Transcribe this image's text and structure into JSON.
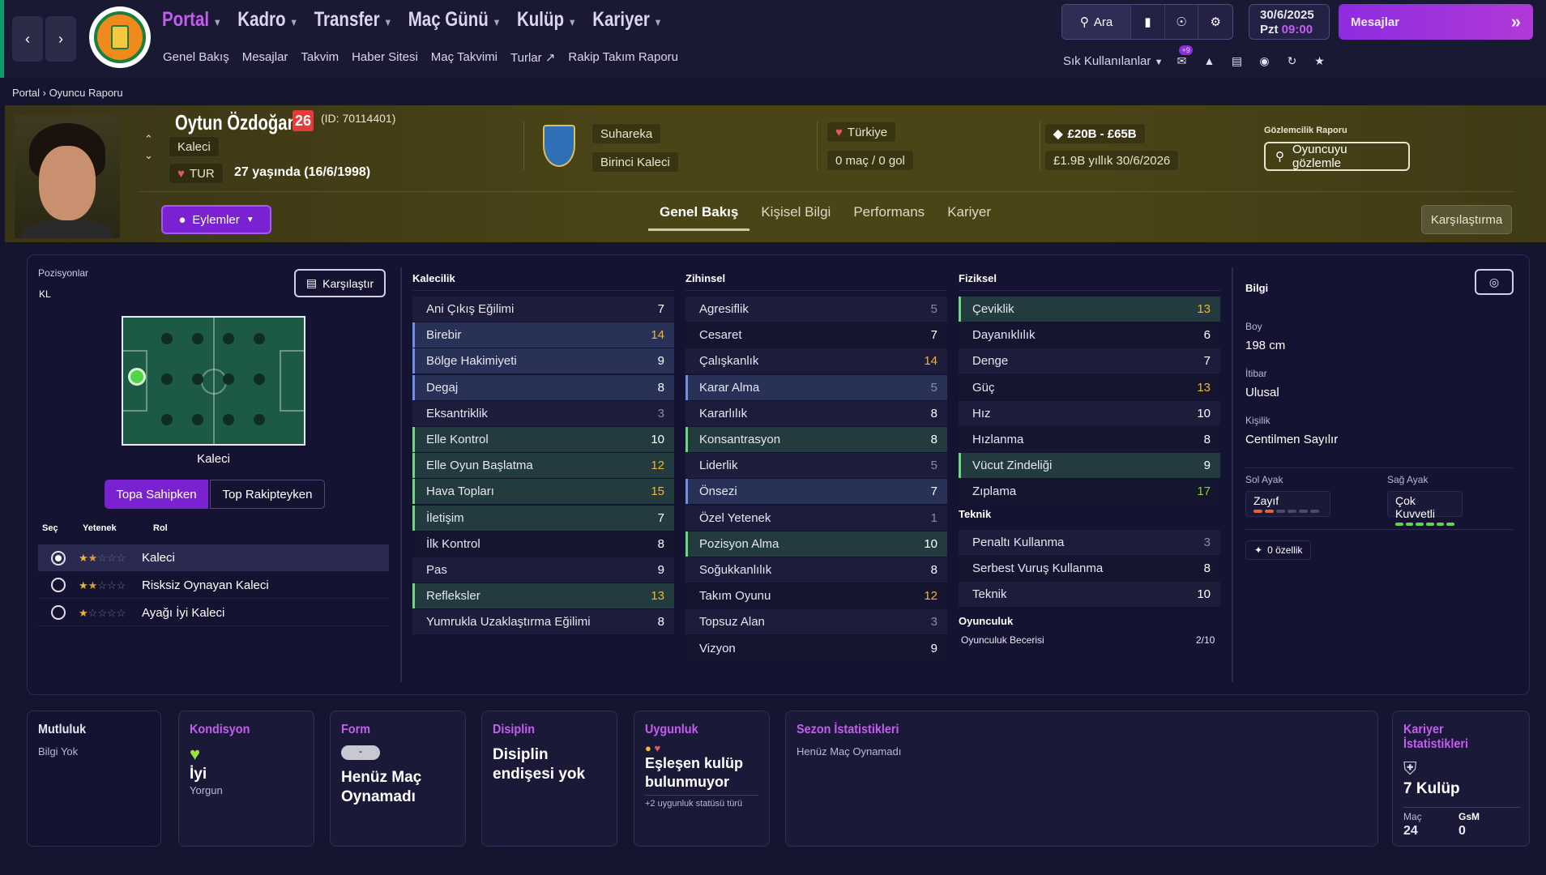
{
  "nav": {
    "main": [
      "Portal",
      "Kadro",
      "Transfer",
      "Maç Günü",
      "Kulüp",
      "Kariyer"
    ],
    "sub": [
      "Genel Bakış",
      "Mesajlar",
      "Takvim",
      "Haber Sitesi",
      "Maç Takvimi",
      "Turlar",
      "Rakip Takım Raporu"
    ],
    "search": "Ara",
    "date": "30/6/2025",
    "day": "Pzt",
    "time": "09:00",
    "messages": "Mesajlar",
    "favorites": "Sık Kullanılanlar",
    "badge": "+9"
  },
  "breadcrumb": {
    "a": "Portal",
    "b": "Oyuncu Raporu"
  },
  "player": {
    "name": "Oytun Özdoğan",
    "number": "26",
    "id": "(ID: 70114401)",
    "position": "Kaleci",
    "nation": "TUR",
    "age": "27 yaşında (16/6/1998)",
    "club": "Suhareka",
    "role": "Birinci Kaleci",
    "country": "Türkiye",
    "caps": "0 maç / 0 gol",
    "value": "£20B - £65B",
    "wage": "£1.9B yıllık",
    "contract": "30/6/2026",
    "scout_title": "Gözlemcilik Raporu",
    "scout_btn": "Oyuncuyu gözlemle",
    "actions": "Eylemler",
    "compare_btn": "Karşılaştırma"
  },
  "tabs": [
    "Genel Bakış",
    "Kişisel Bilgi",
    "Performans",
    "Kariyer"
  ],
  "positions": {
    "title": "Pozisyonlar",
    "code": "KL",
    "compare": "Karşılaştır",
    "label": "Kaleci",
    "toggle_a": "Topa Sahipken",
    "toggle_b": "Top Rakipteyken",
    "col_sel": "Seç",
    "col_skill": "Yetenek",
    "col_role": "Rol",
    "roles": [
      {
        "name": "Kaleci",
        "stars": 1.5
      },
      {
        "name": "Risksiz Oynayan Kaleci",
        "stars": 1.5
      },
      {
        "name": "Ayağı İyi Kaleci",
        "stars": 1
      }
    ]
  },
  "attributes": {
    "gk_title": "Kalecilik",
    "mental_title": "Zihinsel",
    "phys_title": "Fiziksel",
    "tech_title": "Teknik",
    "play_title": "Oyunculuk",
    "gk": [
      [
        "Ani Çıkış Eğilimi",
        "7"
      ],
      [
        "Birebir",
        "14"
      ],
      [
        "Bölge Hakimiyeti",
        "9"
      ],
      [
        "Degaj",
        "8"
      ],
      [
        "Eksantriklik",
        "3"
      ],
      [
        "Elle Kontrol",
        "10"
      ],
      [
        "Elle Oyun Başlatma",
        "12"
      ],
      [
        "Hava Topları",
        "15"
      ],
      [
        "İletişim",
        "7"
      ],
      [
        "İlk Kontrol",
        "8"
      ],
      [
        "Pas",
        "9"
      ],
      [
        "Refleksler",
        "13"
      ],
      [
        "Yumrukla Uzaklaştırma Eğilimi",
        "8"
      ]
    ],
    "mental": [
      [
        "Agresiflik",
        "5"
      ],
      [
        "Cesaret",
        "7"
      ],
      [
        "Çalışkanlık",
        "14"
      ],
      [
        "Karar Alma",
        "5"
      ],
      [
        "Kararlılık",
        "8"
      ],
      [
        "Konsantrasyon",
        "8"
      ],
      [
        "Liderlik",
        "5"
      ],
      [
        "Önsezi",
        "7"
      ],
      [
        "Özel Yetenek",
        "1"
      ],
      [
        "Pozisyon Alma",
        "10"
      ],
      [
        "Soğukkanlılık",
        "8"
      ],
      [
        "Takım Oyunu",
        "12"
      ],
      [
        "Topsuz Alan",
        "3"
      ],
      [
        "Vizyon",
        "9"
      ]
    ],
    "phys": [
      [
        "Çeviklik",
        "13"
      ],
      [
        "Dayanıklılık",
        "6"
      ],
      [
        "Denge",
        "7"
      ],
      [
        "Güç",
        "13"
      ],
      [
        "Hız",
        "10"
      ],
      [
        "Hızlanma",
        "8"
      ],
      [
        "Vücut Zindeliği",
        "9"
      ],
      [
        "Zıplama",
        "17"
      ]
    ],
    "tech": [
      [
        "Penaltı Kullanma",
        "3"
      ],
      [
        "Serbest Vuruş Kullanma",
        "8"
      ],
      [
        "Teknik",
        "10"
      ]
    ],
    "play_label": "Oyunculuk Becerisi",
    "play_value": "2/10"
  },
  "info": {
    "title": "Bilgi",
    "height_l": "Boy",
    "height": "198 cm",
    "rep_l": "İtibar",
    "rep": "Ulusal",
    "pers_l": "Kişilik",
    "pers": "Centilmen Sayılır",
    "left_l": "Sol Ayak",
    "left": "Zayıf",
    "left_level": 2,
    "right_l": "Sağ Ayak",
    "right": "Çok Kuvvetli",
    "right_level": 6,
    "traits": "0 özellik"
  },
  "cards": {
    "happy_t": "Mutluluk",
    "happy": "Bilgi Yok",
    "cond_t": "Kondisyon",
    "cond": "İyi",
    "cond_s": "Yorgun",
    "form_t": "Form",
    "form_badge": "-",
    "form": "Henüz Maç Oynamadı",
    "disc_t": "Disiplin",
    "disc": "Disiplin endişesi yok",
    "elig_t": "Uygunluk",
    "elig": "Eşleşen kulüp bulunmuyor",
    "elig_s": "+2 uygunluk statüsü türü",
    "season_t": "Sezon İstatistikleri",
    "season": "Henüz Maç Oynamadı",
    "career_t": "Kariyer İstatistikleri",
    "career": "7 Kulüp",
    "apps_l": "Maç",
    "apps": "24",
    "gls_l": "GsM",
    "gls": "0"
  }
}
